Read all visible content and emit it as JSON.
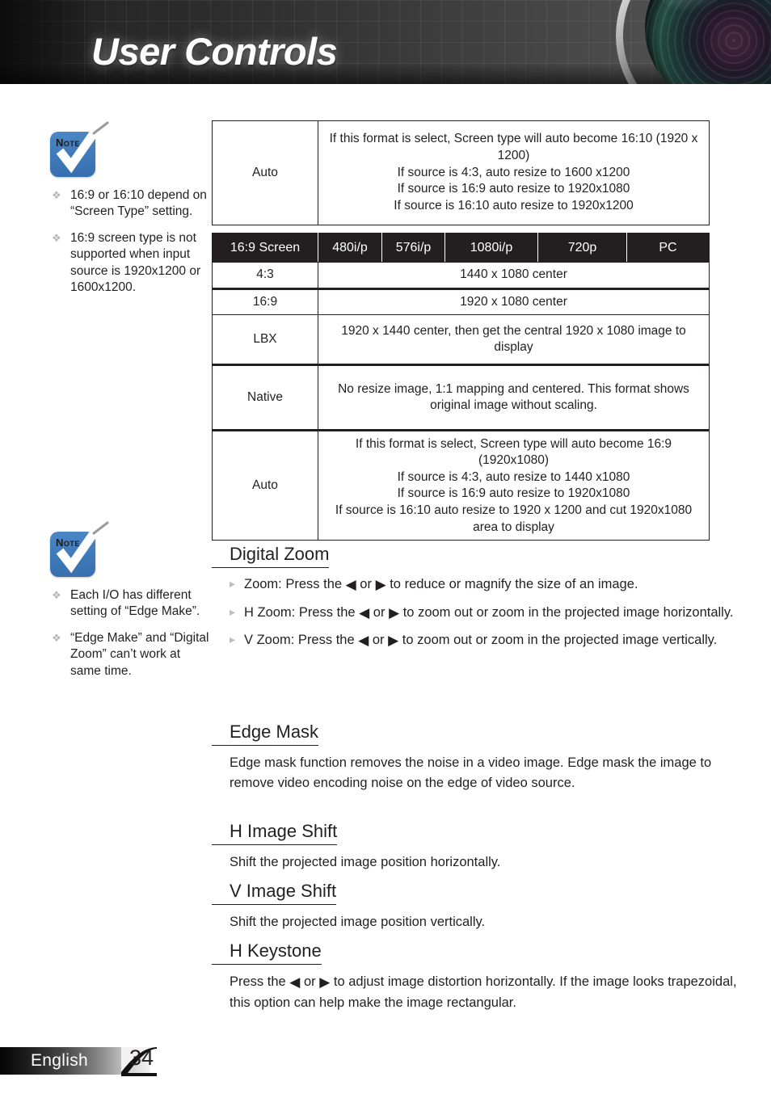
{
  "header": {
    "title": "User Controls",
    "lens_icon": "camera-lens-graphic"
  },
  "notes": [
    {
      "icon": "note-icon",
      "icon_label": "Note",
      "items": [
        "16:9 or 16:10 depend on “Screen Type” setting.",
        " 16:9 screen type is not supported when input source is 1920x1200  or 1600x1200."
      ]
    },
    {
      "icon": "note-icon",
      "icon_label": "Note",
      "items": [
        "Each I/O has different setting of “Edge Make”.",
        "“Edge Make” and “Digital Zoom” can’t work at same time."
      ]
    }
  ],
  "table_auto": {
    "label": "Auto",
    "description": "If this format is select, Screen type will auto become 16:10 (1920 x 1200)\nIf source is 4:3, auto resize to 1600 x1200\nIf source is 16:9 auto resize to 1920x1080\nIf source is 16:10 auto resize to 1920x1200"
  },
  "table_169": {
    "headers": [
      "16:9 Screen",
      "480i/p",
      "576i/p",
      "1080i/p",
      "720p",
      "PC"
    ],
    "rows": [
      {
        "label": "4:3",
        "value": "1440 x 1080 center"
      },
      {
        "label": "16:9",
        "value": "1920 x 1080 center"
      },
      {
        "label": "LBX",
        "value": "1920 x 1440 center, then get the central 1920 x 1080 image to display"
      },
      {
        "label": "Native",
        "value": "No resize image, 1:1 mapping and centered. This format shows original image without scaling."
      },
      {
        "label": "Auto",
        "value": "If this format is select, Screen type will auto become 16:9 (1920x1080)\nIf source is 4:3, auto resize to 1440 x1080\nIf source is 16:9 auto resize to 1920x1080\nIf source is 16:10 auto resize to 1920 x 1200 and cut 1920x1080 area to display"
      }
    ]
  },
  "sections": [
    {
      "title": "Digital Zoom",
      "bullets": [
        {
          "pre": "Zoom: Press the ",
          "mid": " or ",
          "post": " to reduce or magnify the size of an image."
        },
        {
          "pre": "H Zoom: Press the ",
          "mid": " or ",
          "post": " to zoom out or zoom in the projected image horizontally."
        },
        {
          "pre": "V Zoom: Press the ",
          "mid": " or ",
          "post": " to zoom out or zoom in the projected image vertically."
        }
      ]
    },
    {
      "title": "Edge Mask",
      "body": "Edge mask function removes the noise in a video image. Edge mask the image to remove video encoding noise on the edge of video source."
    },
    {
      "title": "H Image Shift",
      "body": "Shift the projected image position horizontally."
    },
    {
      "title": "V Image Shift",
      "body": "Shift the projected image position vertically."
    },
    {
      "title": "H Keystone",
      "pre": "Press the ",
      "mid": " or ",
      "post": " to adjust image distortion horizontally. If the image looks trapezoidal, this option can help make the image rectangular."
    }
  ],
  "icons": {
    "left_arrow": "◀",
    "right_arrow": "▶",
    "diamond_bullet": "❖",
    "triangle_bullet": "▸"
  },
  "footer": {
    "language": "English",
    "page": "34"
  },
  "colors": {
    "note_blue": "#3f79b9",
    "ink": "#231f20",
    "banner_dark": "#2e2e2e"
  }
}
